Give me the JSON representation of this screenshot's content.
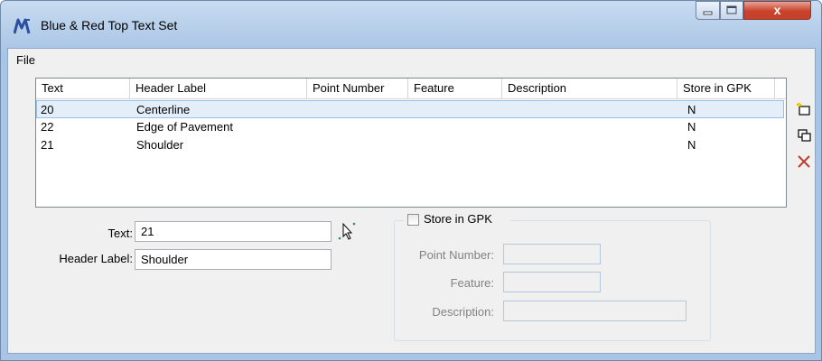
{
  "window": {
    "title": "Blue & Red Top Text Set",
    "controls": {
      "close": "x"
    }
  },
  "menu": {
    "file": "File"
  },
  "table": {
    "columns": [
      "Text",
      "Header Label",
      "Point Number",
      "Feature",
      "Description",
      "Store in GPK"
    ],
    "rows": [
      {
        "text": "20",
        "header_label": "Centerline",
        "point_number": "",
        "feature": "",
        "description": "",
        "store_in_gpk": "N",
        "selected": true
      },
      {
        "text": "22",
        "header_label": "Edge of Pavement",
        "point_number": "",
        "feature": "",
        "description": "",
        "store_in_gpk": "N",
        "selected": false
      },
      {
        "text": "21",
        "header_label": "Shoulder",
        "point_number": "",
        "feature": "",
        "description": "",
        "store_in_gpk": "N",
        "selected": false
      }
    ]
  },
  "side_buttons": [
    {
      "icon": "new-icon"
    },
    {
      "icon": "copy-icon"
    },
    {
      "icon": "delete-icon",
      "color": "#c0392b"
    }
  ],
  "form": {
    "text_label": "Text:",
    "text_value": "21",
    "header_label": "Header Label:",
    "header_value": "Shoulder"
  },
  "gpk": {
    "checkbox_label": "Store in GPK",
    "checked": false,
    "point_number_label": "Point Number:",
    "point_number_value": "",
    "feature_label": "Feature:",
    "feature_value": "",
    "description_label": "Description:",
    "description_value": ""
  },
  "colors": {
    "title_gradient": "#b7cfea",
    "close_button": "#c7402a",
    "selection": "#e4eef9"
  }
}
